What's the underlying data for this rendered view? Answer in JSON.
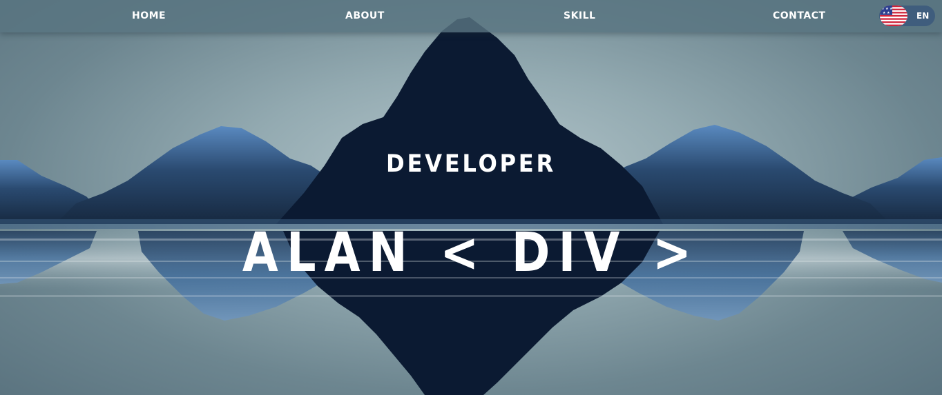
{
  "nav": {
    "home_label": "HOME",
    "about_label": "ABOUT",
    "skill_label": "SKILL",
    "contact_label": "CONTACT"
  },
  "language": {
    "label": "EN",
    "flag_icon": "us-flag-icon"
  },
  "hero": {
    "subtitle": "DEVELOPER",
    "title": "ALAN < DIV >"
  },
  "colors": {
    "navbar": "#587480",
    "mountain_dark": "#0b1a32",
    "mountain_blue": "#4a78a6",
    "lang_toggle": "#3f5d7d",
    "text": "#ffffff"
  }
}
